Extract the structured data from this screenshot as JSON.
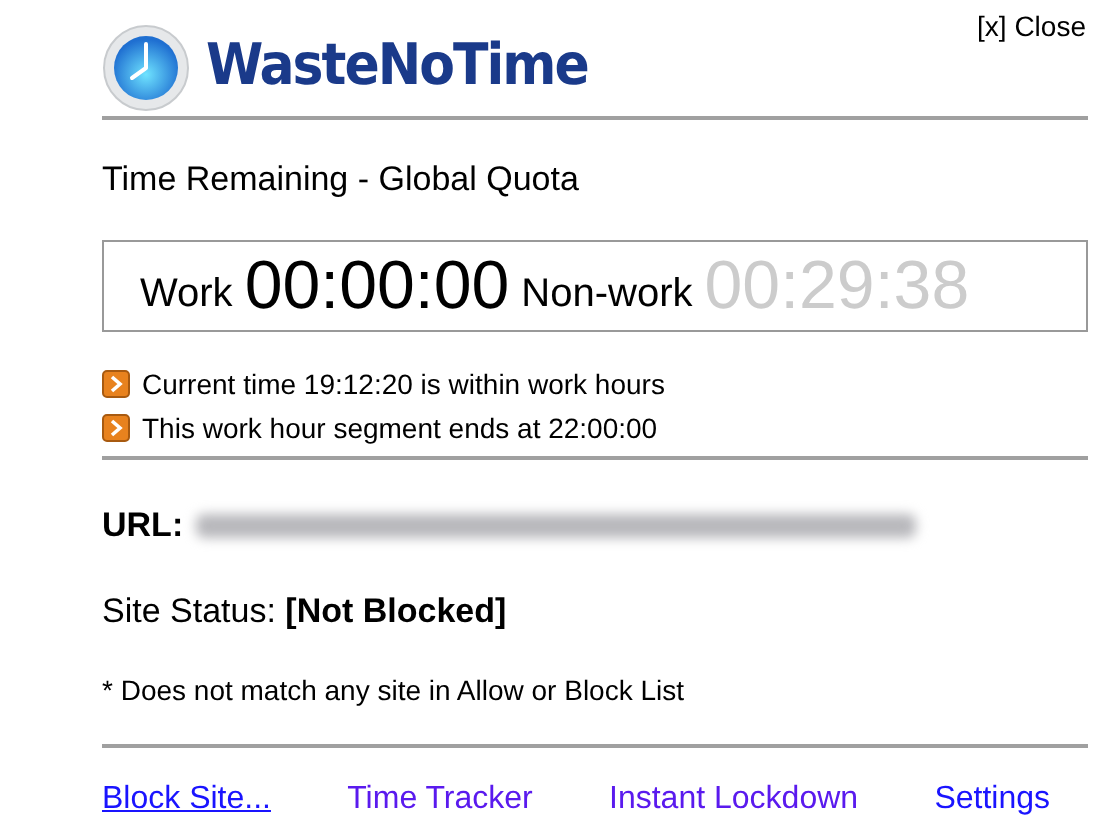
{
  "close_link": "[x] Close",
  "logo_text": "WasteNoTime",
  "heading": "Time Remaining - Global Quota",
  "quota": {
    "work_label": "Work",
    "work_time": "00:00:00",
    "work_dimmed": false,
    "nonwork_label": "Non-work",
    "nonwork_time": "00:29:38",
    "nonwork_dimmed": true
  },
  "notes": [
    "Current time 19:12:20 is within work hours",
    "This work hour segment ends at 22:00:00"
  ],
  "url_label": "URL:",
  "site_status": {
    "label": "Site Status:",
    "value": "[Not Blocked]"
  },
  "footnote": "* Does not match any site in Allow or Block List",
  "links": [
    {
      "label": "Block Site...",
      "visited": false,
      "hovered": true
    },
    {
      "label": "Time Tracker",
      "visited": true,
      "hovered": false
    },
    {
      "label": "Instant Lockdown",
      "visited": true,
      "hovered": false
    },
    {
      "label": "Settings",
      "visited": false,
      "hovered": false
    }
  ]
}
